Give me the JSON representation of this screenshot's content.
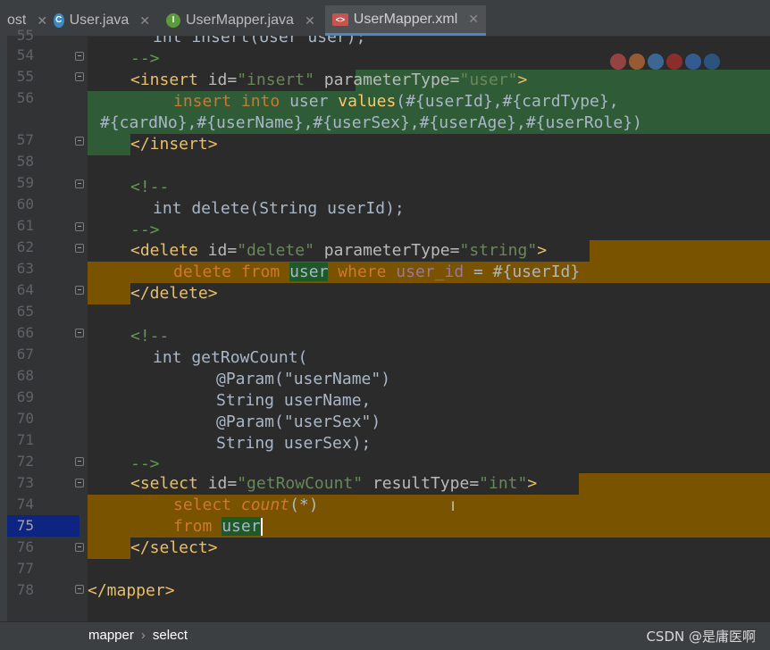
{
  "tabs": [
    {
      "label": "ost",
      "icon": "",
      "active": false
    },
    {
      "label": "User.java",
      "icon": "C",
      "active": false
    },
    {
      "label": "UserMapper.java",
      "icon": "I",
      "active": false
    },
    {
      "label": "UserMapper.xml",
      "icon": "<>",
      "active": true
    }
  ],
  "line_numbers": [
    "55",
    "54",
    "55",
    "56",
    "57",
    "58",
    "59",
    "60",
    "61",
    "62",
    "63",
    "64",
    "65",
    "66",
    "67",
    "68",
    "69",
    "70",
    "71",
    "72",
    "73",
    "74",
    "75",
    "76",
    "77",
    "78"
  ],
  "current_line": "75",
  "code": {
    "l53": "int insert(User user);",
    "l54": "-->",
    "l55_open": "<insert",
    "l55_attr1": "id=",
    "l55_val1": "\"insert\"",
    "l55_attr2": "parameterType=",
    "l55_val2": "\"user\"",
    "l55_close": ">",
    "l56a_kw": "insert into",
    "l56a_tbl": "user",
    "l56a_kw2": "values",
    "l56a_rest": "(#{userId},#{cardType},",
    "l56b": "#{cardNo},#{userName},#{userSex},#{userAge},#{userRole})",
    "l57": "</insert>",
    "l59": "<!--",
    "l60": "int delete(String userId);",
    "l61": "-->",
    "l62_open": "<delete",
    "l62_attr1": "id=",
    "l62_val1": "\"delete\"",
    "l62_attr2": "parameterType=",
    "l62_val2": "\"string\"",
    "l62_close": ">",
    "l63_kw": "delete from",
    "l63_tbl": "user",
    "l63_kw2": "where",
    "l63_col": "user_id",
    "l63_rest": " = #{userId}",
    "l64": "</delete>",
    "l66": "<!--",
    "l67": "int getRowCount(",
    "l68": "@Param(\"userName\")",
    "l69": "String userName,",
    "l70": "@Param(\"userSex\")",
    "l71": "String userSex);",
    "l72": "-->",
    "l73_open": "<select",
    "l73_attr1": "id=",
    "l73_val1": "\"getRowCount\"",
    "l73_attr2": "resultType=",
    "l73_val2": "\"int\"",
    "l73_close": ">",
    "l74_kw": "select",
    "l74_fn": "count",
    "l74_rest": "(*)",
    "l75_kw": "from",
    "l75_tbl": "user",
    "l76": "</select>",
    "l78": "</mapper>"
  },
  "breadcrumb": {
    "item1": "mapper",
    "sep": "›",
    "item2": "select"
  },
  "watermark": "CSDN @是庸医啊",
  "colors": {
    "tag": "#e8bf6a",
    "string": "#6a8759",
    "keyword": "#cc7832",
    "comment": "#629755",
    "insert_highlight": "#2f5c36",
    "select_highlight": "#7a5300"
  }
}
